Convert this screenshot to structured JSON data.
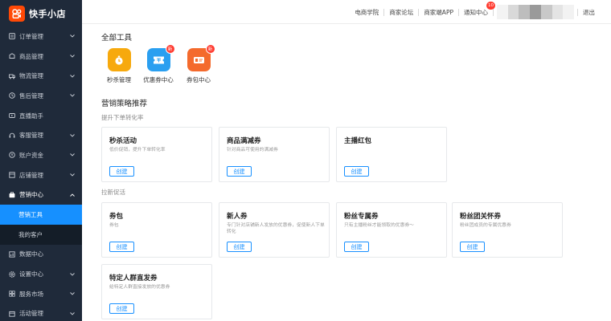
{
  "brand": {
    "name": "快手小店"
  },
  "header": {
    "links": [
      "电商学院",
      "商家论坛",
      "商家端APP",
      "通知中心"
    ],
    "notification_count": "10",
    "logout": "退出"
  },
  "sidebar": {
    "items": [
      {
        "label": "订单管理",
        "icon": "order-icon"
      },
      {
        "label": "商品管理",
        "icon": "goods-icon"
      },
      {
        "label": "物流管理",
        "icon": "logistics-icon"
      },
      {
        "label": "售后管理",
        "icon": "aftersale-icon"
      },
      {
        "label": "直播助手",
        "icon": "live-icon"
      },
      {
        "label": "客服管理",
        "icon": "service-icon"
      },
      {
        "label": "账户资金",
        "icon": "funds-icon"
      },
      {
        "label": "店铺管理",
        "icon": "shop-icon"
      },
      {
        "label": "营销中心",
        "icon": "marketing-icon"
      },
      {
        "label": "数据中心",
        "icon": "data-icon"
      },
      {
        "label": "设置中心",
        "icon": "settings-icon"
      },
      {
        "label": "服务市场",
        "icon": "market-icon"
      },
      {
        "label": "活动管理",
        "icon": "activity-icon"
      }
    ],
    "sub_items": [
      "营销工具",
      "我的客户"
    ]
  },
  "main": {
    "all_tools_title": "全部工具",
    "tools": [
      {
        "name": "秒杀管理",
        "color": "#f7a90d",
        "icon": "stopwatch-icon",
        "badge": ""
      },
      {
        "name": "优惠券中心",
        "color": "#2a9ff0",
        "icon": "coupon-icon",
        "badge": "新"
      },
      {
        "name": "券包中心",
        "color": "#f46a2d",
        "icon": "coupon-pack-icon",
        "badge": "新"
      }
    ],
    "strategy_title": "营销策略推荐",
    "group1_label": "提升下单转化率",
    "group2_label": "拉新促活",
    "create_label": "创建",
    "cards": [
      {
        "title": "秒杀活动",
        "desc": "低价促销，提升下单转化率"
      },
      {
        "title": "商品满减券",
        "desc": "针对商品可使用的满减券"
      },
      {
        "title": "主播红包",
        "desc": ""
      },
      {
        "title": "券包",
        "desc": "券包"
      },
      {
        "title": "新人券",
        "desc": "专门针对店铺新人发放的优惠券，促使新人下单转化"
      },
      {
        "title": "粉丝专属券",
        "desc": "只有主播粉丝才能领取的优惠券～"
      },
      {
        "title": "粉丝团关怀券",
        "desc": "粉丝团成员的专属优惠券"
      },
      {
        "title": "特定人群直发券",
        "desc": "给特定人群直接发放的优惠券"
      }
    ]
  },
  "colors": {
    "sidebar_bg": "#1f2a3a",
    "accent": "#1890ff",
    "brand": "#ff4906"
  }
}
